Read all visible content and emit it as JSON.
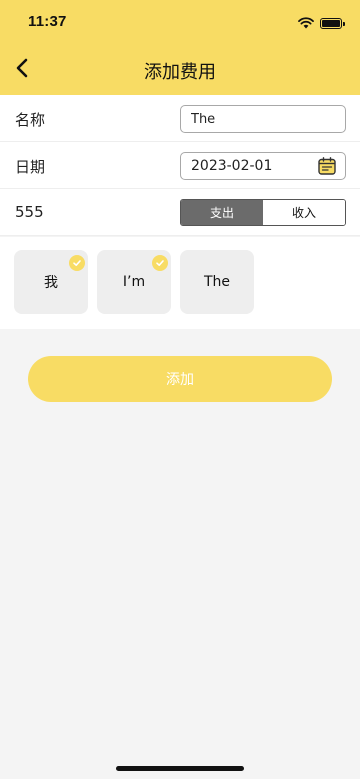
{
  "status_bar": {
    "time": "11:37"
  },
  "nav": {
    "title": "添加费用",
    "back_icon": "chevron-left-icon"
  },
  "form": {
    "name_label": "名称",
    "name_value": "The",
    "date_label": "日期",
    "date_value": "2023-02-01",
    "amount_label": "555",
    "type_options": [
      "支出",
      "收入"
    ],
    "type_selected": "支出"
  },
  "tags": [
    {
      "label": "我",
      "checked": true
    },
    {
      "label": "I’m",
      "checked": true
    },
    {
      "label": "The",
      "checked": false
    }
  ],
  "actions": {
    "add_label": "添加"
  },
  "colors": {
    "accent": "#f8dc64",
    "segment_active": "#6b6b6b",
    "background": "#f4f4f4"
  }
}
